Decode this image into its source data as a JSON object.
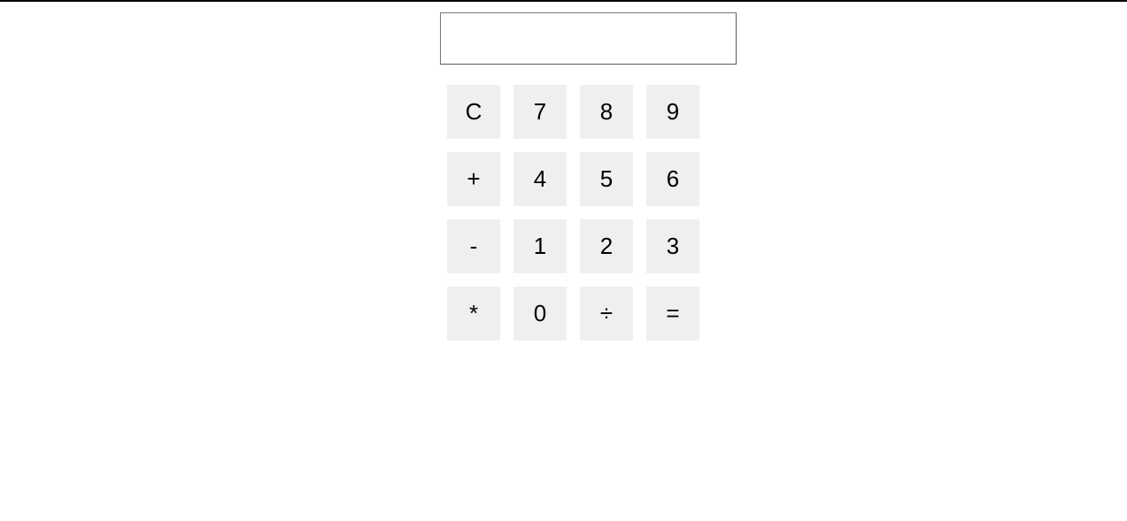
{
  "display": {
    "value": ""
  },
  "keypad": {
    "rows": [
      [
        {
          "label": "C",
          "name": "clear-button"
        },
        {
          "label": "7",
          "name": "digit-7-button"
        },
        {
          "label": "8",
          "name": "digit-8-button"
        },
        {
          "label": "9",
          "name": "digit-9-button"
        }
      ],
      [
        {
          "label": "+",
          "name": "add-button"
        },
        {
          "label": "4",
          "name": "digit-4-button"
        },
        {
          "label": "5",
          "name": "digit-5-button"
        },
        {
          "label": "6",
          "name": "digit-6-button"
        }
      ],
      [
        {
          "label": "-",
          "name": "subtract-button"
        },
        {
          "label": "1",
          "name": "digit-1-button"
        },
        {
          "label": "2",
          "name": "digit-2-button"
        },
        {
          "label": "3",
          "name": "digit-3-button"
        }
      ],
      [
        {
          "label": "*",
          "name": "multiply-button"
        },
        {
          "label": "0",
          "name": "digit-0-button"
        },
        {
          "label": "÷",
          "name": "divide-button"
        },
        {
          "label": "=",
          "name": "equals-button"
        }
      ]
    ]
  },
  "colors": {
    "key_background": "#efefef",
    "top_rule": "#000000",
    "display_border": "#767676"
  }
}
